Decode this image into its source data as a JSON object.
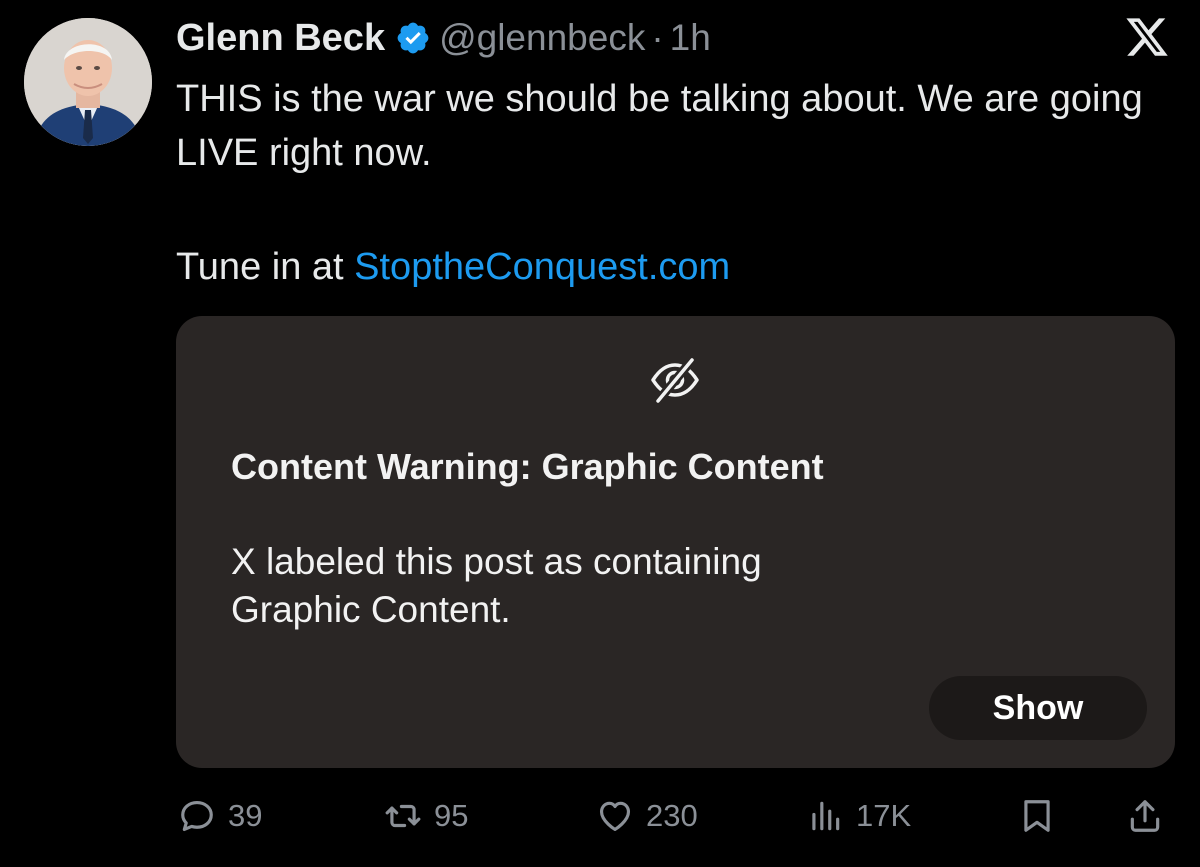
{
  "post": {
    "author_name": "Glenn Beck",
    "handle": "@glennbeck",
    "separator": "·",
    "time": "1h",
    "text": "THIS is the war we should be talking about. We are going LIVE right now.",
    "tune_in_prefix": "Tune in at ",
    "link_text": "StoptheConquest.com"
  },
  "warning": {
    "title": "Content Warning: Graphic Content",
    "body": "X labeled this post as containing Graphic Content.",
    "show_label": "Show"
  },
  "actions": {
    "replies": "39",
    "reposts": "95",
    "likes": "230",
    "views": "17K"
  },
  "colors": {
    "background": "#000000",
    "card": "#2a2625",
    "link": "#1d9bf0",
    "verified": "#1d9bf0",
    "muted": "#8b9097"
  },
  "icons": {
    "verified": "verified-badge-icon",
    "logo": "x-logo-icon",
    "hidden": "eye-off-icon",
    "reply": "reply-icon",
    "repost": "repost-icon",
    "like": "heart-icon",
    "views": "views-icon",
    "bookmark": "bookmark-icon",
    "share": "share-icon"
  }
}
